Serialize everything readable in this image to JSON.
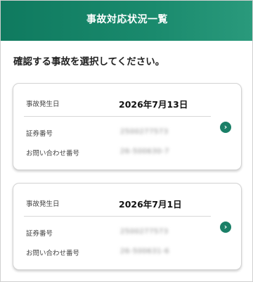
{
  "header": {
    "title": "事故対応状況一覧"
  },
  "instruction": "確認する事故を選択してください。",
  "cards": [
    {
      "date_label": "事故発生日",
      "date": "2026年7月13日",
      "policy_label": "証券番号",
      "policy_number": "2500277573",
      "inquiry_label": "お問い合わせ番号",
      "inquiry_number": "26-500630-7",
      "arrow_icon": "chevron-right-icon"
    },
    {
      "date_label": "事故発生日",
      "date": "2026年7月1日",
      "policy_label": "証券番号",
      "policy_number": "2500277573",
      "inquiry_label": "お問い合わせ番号",
      "inquiry_number": "26-500631-6",
      "arrow_icon": "chevron-right-icon"
    }
  ],
  "colors": {
    "header": "#0f7a5f",
    "accent": "#1a7f67"
  }
}
